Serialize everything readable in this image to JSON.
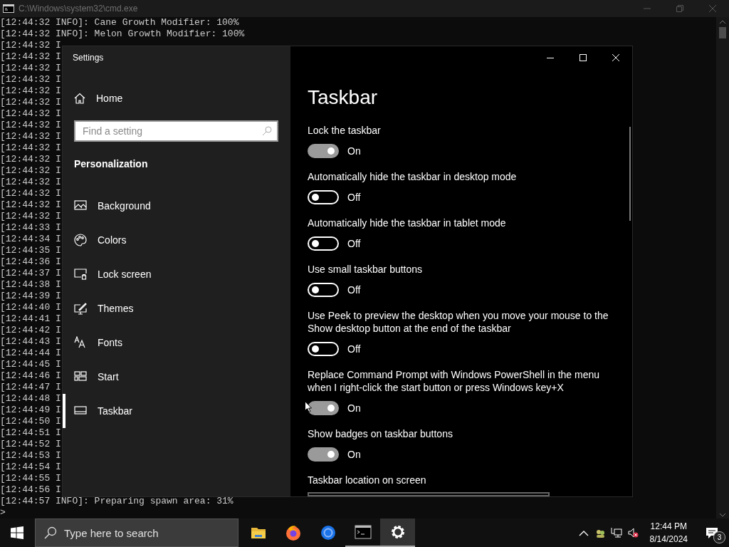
{
  "console": {
    "title": "C:\\Windows\\system32\\cmd.exe",
    "lines": [
      "[12:44:32 INFO]: Cane Growth Modifier: 100%",
      "[12:44:32 INFO]: Melon Growth Modifier: 100%",
      "[12:44:32 I",
      "[12:44:32 I",
      "[12:44:32 I",
      "[12:44:32 I",
      "[12:44:32 I",
      "[12:44:32 I",
      "[12:44:32 I",
      "[12:44:32 I",
      "[12:44:32 I",
      "[12:44:32 I",
      "[12:44:32 I",
      "[12:44:32 I",
      "[12:44:32 I",
      "[12:44:32 I",
      "[12:44:32 I",
      "[12:44:32 I",
      "[12:44:33 I",
      "[12:44:34 I",
      "[12:44:35 I",
      "[12:44:36 I",
      "[12:44:37 I",
      "[12:44:38 I",
      "[12:44:39 I",
      "[12:44:40 I",
      "[12:44:41 I",
      "[12:44:42 I",
      "[12:44:43 I",
      "[12:44:44 I",
      "[12:44:45 I",
      "[12:44:46 I",
      "[12:44:47 I",
      "[12:44:48 I",
      "[12:44:49 I",
      "[12:44:50 I",
      "[12:44:51 I",
      "[12:44:52 I",
      "[12:44:53 I",
      "[12:44:54 I",
      "[12:44:55 I",
      "[12:44:56 I",
      "[12:44:57 INFO]: Preparing spawn area: 31%",
      ">"
    ]
  },
  "settings": {
    "title": "Settings",
    "home": "Home",
    "search": {
      "placeholder": "Find a setting"
    },
    "section": "Personalization",
    "nav_items": [
      {
        "kind": "background",
        "label": "Background",
        "selected": false
      },
      {
        "kind": "colors",
        "label": "Colors",
        "selected": false
      },
      {
        "kind": "lockscreen",
        "label": "Lock screen",
        "selected": false
      },
      {
        "kind": "themes",
        "label": "Themes",
        "selected": false
      },
      {
        "kind": "fonts",
        "label": "Fonts",
        "selected": false
      },
      {
        "kind": "start",
        "label": "Start",
        "selected": false
      },
      {
        "kind": "taskbar",
        "label": "Taskbar",
        "selected": true
      }
    ],
    "page_title": "Taskbar",
    "options": [
      {
        "label": "Lock the taskbar",
        "on": true,
        "state": "On"
      },
      {
        "label": "Automatically hide the taskbar in desktop mode",
        "on": false,
        "state": "Off"
      },
      {
        "label": "Automatically hide the taskbar in tablet mode",
        "on": false,
        "state": "Off"
      },
      {
        "label": "Use small taskbar buttons",
        "on": false,
        "state": "Off"
      },
      {
        "label": "Use Peek to preview the desktop when you move your mouse to the Show desktop button at the end of the taskbar",
        "on": false,
        "state": "Off"
      },
      {
        "label": "Replace Command Prompt with Windows PowerShell in the menu when I right-click the start button or press Windows key+X",
        "on": true,
        "state": "On"
      },
      {
        "label": "Show badges on taskbar buttons",
        "on": true,
        "state": "On"
      }
    ],
    "location_label": "Taskbar location on screen"
  },
  "taskbar": {
    "search_placeholder": "Type here to search",
    "apps": [
      {
        "kind": "folder",
        "running": false,
        "selected": false
      },
      {
        "kind": "firefox",
        "running": false,
        "selected": false
      },
      {
        "kind": "browser",
        "running": false,
        "selected": false
      },
      {
        "kind": "console",
        "running": true,
        "selected": false
      },
      {
        "kind": "gear",
        "running": true,
        "selected": true
      }
    ],
    "time": "12:44 PM",
    "date": "8/14/2024",
    "notification_count": "3"
  }
}
